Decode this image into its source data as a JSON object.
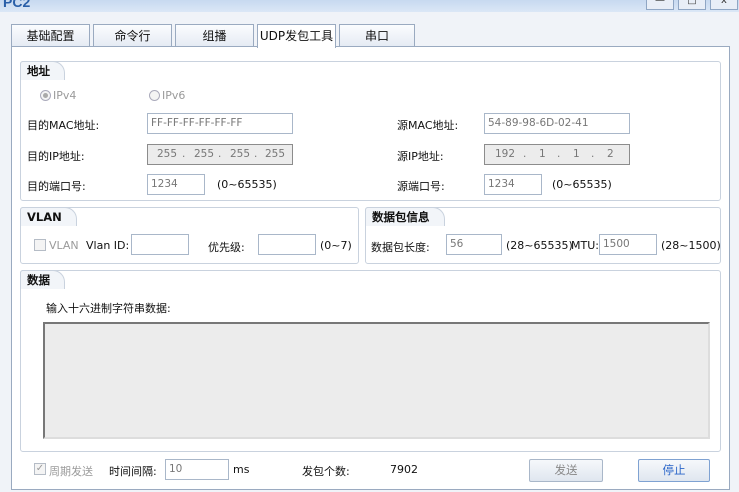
{
  "window": {
    "title": "PC2"
  },
  "tabs": [
    "基础配置",
    "命令行",
    "组播",
    "UDP发包工具",
    "串口"
  ],
  "address": {
    "title": "地址",
    "ipv4_label": "IPv4",
    "ipv6_label": "IPv6",
    "dst_mac_label": "目的MAC地址:",
    "dst_mac_value": "FF-FF-FF-FF-FF-FF",
    "src_mac_label": "源MAC地址:",
    "src_mac_value": "54-89-98-6D-02-41",
    "dst_ip_label": "目的IP地址:",
    "dst_ip": [
      "255",
      "255",
      "255",
      "255"
    ],
    "src_ip_label": "源IP地址:",
    "src_ip": [
      "192",
      "1",
      "1",
      "2"
    ],
    "dst_port_label": "目的端口号:",
    "dst_port_value": "1234",
    "dst_port_range": "(0~65535)",
    "src_port_label": "源端口号:",
    "src_port_value": "1234",
    "src_port_range": "(0~65535)"
  },
  "vlan": {
    "title": "VLAN",
    "checkbox_label": "VLAN",
    "vlan_id_label": "Vlan ID:",
    "priority_label": "优先级:",
    "priority_range": "(0~7)"
  },
  "packet": {
    "title": "数据包信息",
    "length_label": "数据包长度:",
    "length_value": "56",
    "length_range": "(28~65535)",
    "mtu_label": "MTU:",
    "mtu_value": "1500",
    "mtu_range": "(28~1500)"
  },
  "data": {
    "title": "数据",
    "hex_label": "输入十六进制字符串数据:"
  },
  "bottom": {
    "periodic_label": "周期发送",
    "interval_label": "时间间隔:",
    "interval_value": "10",
    "interval_unit": "ms",
    "count_label": "发包个数:",
    "count_value": "7902",
    "send_button": "发送",
    "stop_button": "停止"
  },
  "window_buttons": {
    "minimize": "—",
    "maximize": "□",
    "close": "x"
  }
}
